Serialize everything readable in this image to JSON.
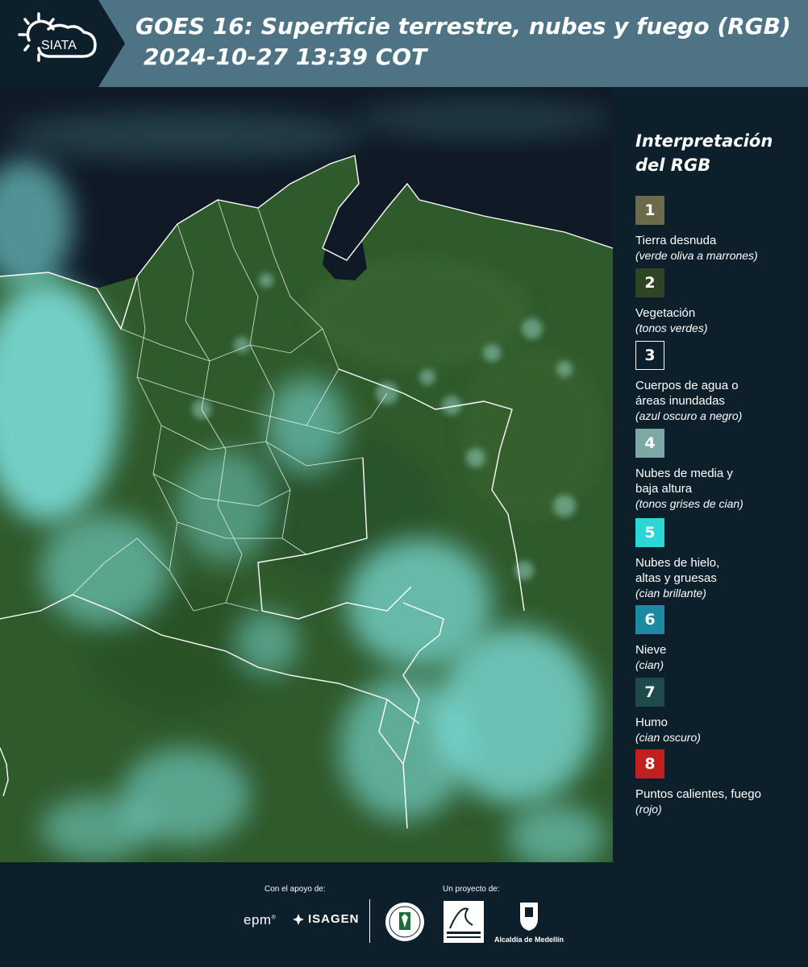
{
  "header": {
    "logo_text": "SIATA",
    "title": "GOES 16: Superficie terrestre, nubes y fuego (RGB)",
    "subtitle": "2024-10-27 13:39 COT"
  },
  "legend": {
    "title_line1": "Interpretación",
    "title_line2": "del RGB",
    "items": [
      {
        "number": "1",
        "label": "Tierra desnuda",
        "hint": "(verde oliva a marrones)",
        "color": "#6b6a4a"
      },
      {
        "number": "2",
        "label": "Vegetación",
        "hint": "(tonos verdes)",
        "color": "#2e4423"
      },
      {
        "number": "3",
        "label": "Cuerpos de agua o áreas inundadas",
        "hint": "(azul oscuro a negro)",
        "color": "#0c1f2b"
      },
      {
        "number": "4",
        "label": "Nubes de media y baja altura",
        "hint": "(tonos grises de cian)",
        "color": "#7ea8a6"
      },
      {
        "number": "5",
        "label": "Nubes de hielo, altas y gruesas",
        "hint": "(cian brillante)",
        "color": "#2ad6d6"
      },
      {
        "number": "6",
        "label": "Nieve",
        "hint": "(cian)",
        "color": "#1c8aa0"
      },
      {
        "number": "7",
        "label": "Humo",
        "hint": "(cian oscuro)",
        "color": "#1e4a4c"
      },
      {
        "number": "8",
        "label": "Puntos calientes, fuego",
        "hint": "(rojo)",
        "color": "#c2201f"
      }
    ]
  },
  "footer": {
    "support_label": "Con el apoyo de:",
    "project_label": "Un proyecto de:",
    "epm": "epm",
    "isagen": "ISAGEN",
    "alcaldia": "Alcaldía de Medellín"
  },
  "map": {
    "land_color": "#2f5a2c",
    "sea_color": "#0f1a26",
    "cloud_color": "#7fe3e0",
    "border_color": "#ffffff"
  }
}
